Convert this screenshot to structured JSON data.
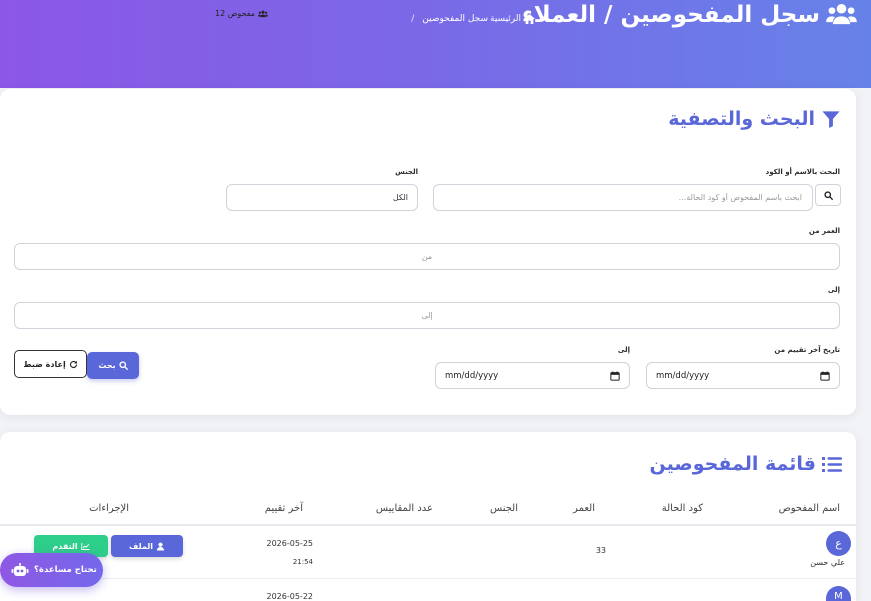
{
  "header": {
    "title": "سجل المفحوصين / العملاء",
    "title_icon": "users-icon",
    "breadcrumb": {
      "home": "الرئيسية",
      "home_icon": "home-icon",
      "current": "سجل المفحوصين",
      "separator": "/"
    },
    "count": "12 مفحوص",
    "count_icon": "users-icon"
  },
  "filters": {
    "title": "البحث والتصفية",
    "title_icon": "filter-icon",
    "search": {
      "label": "البحث بالاسم أو الكود",
      "placeholder": "ابحث باسم المفحوص أو كود الحالة...",
      "button_icon": "search-icon"
    },
    "gender": {
      "label": "الجنس",
      "selected": "الكل"
    },
    "age_from": {
      "label": "العمر من",
      "placeholder": "من"
    },
    "age_to": {
      "label": "إلى",
      "placeholder": "إلى"
    },
    "date_from": {
      "label": "تاريخ آخر تقييم من",
      "placeholder": "mm/dd/yyyy"
    },
    "date_to": {
      "label": "إلى",
      "placeholder": "mm/dd/yyyy"
    },
    "search_button": "بحث",
    "reset_button": "إعادة ضبط"
  },
  "list": {
    "title": "قائمة المفحوصين",
    "title_icon": "list-icon",
    "columns": [
      "اسم المفحوص",
      "كود الحالة",
      "العمر",
      "الجنس",
      "عدد المقاييس",
      "آخر تقييم",
      "الإجراءات"
    ],
    "rows": [
      {
        "avatar_letter": "ع",
        "name": "علي حسن",
        "age": "33",
        "last_assessment_date": "2026-05-25",
        "last_assessment_time": "21:54",
        "actions": {
          "profile": "الملف",
          "progress": "التقدم"
        }
      },
      {
        "avatar_letter": "M",
        "last_assessment_date": "2026-05-22"
      }
    ]
  },
  "help_button": {
    "label": "تحتاج مساعدة؟",
    "icon": "robot-icon"
  },
  "colors": {
    "header_gradient_start": "#8c57e6",
    "header_gradient_end": "#6682e8",
    "accent": "#5a67d8",
    "success": "#2dce89"
  }
}
